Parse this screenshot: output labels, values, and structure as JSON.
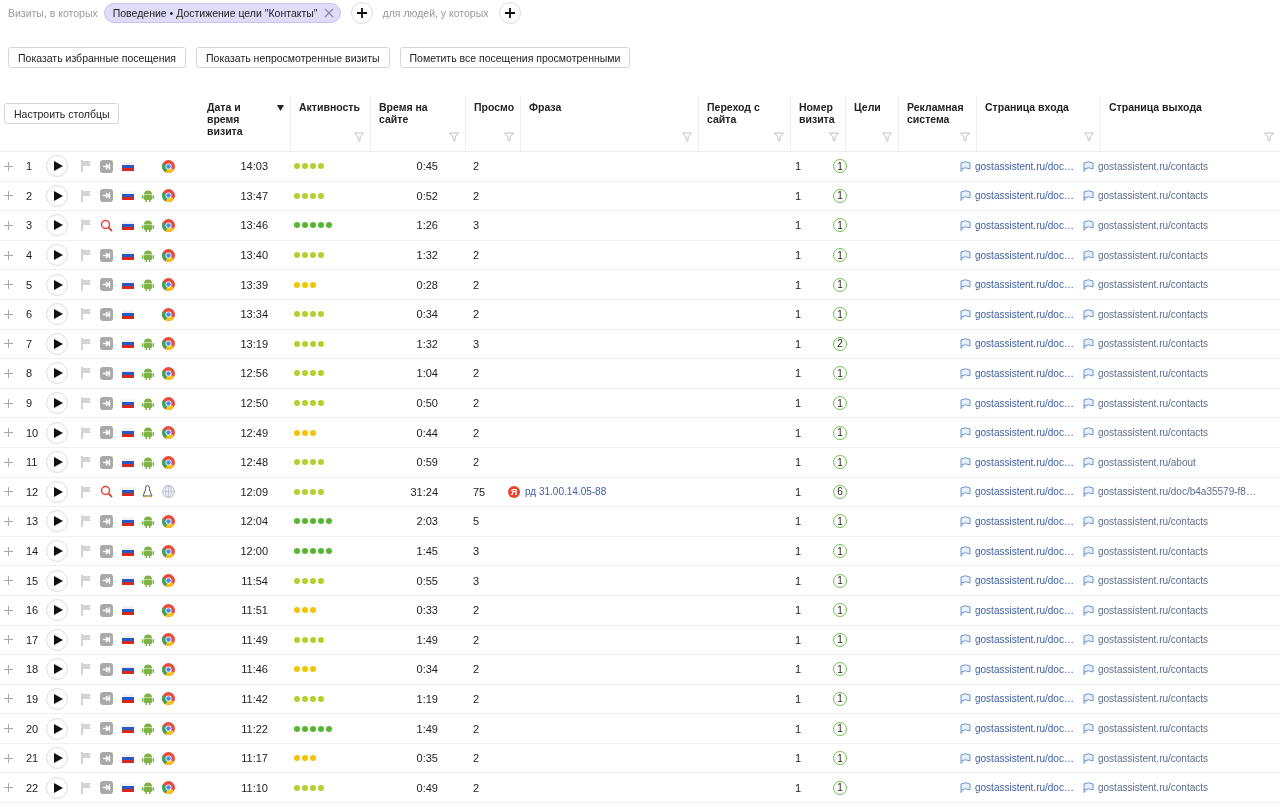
{
  "filter_bar": {
    "label": "Визиты, в которых",
    "condition": "Поведение • Достижение цели \"Контакты\"",
    "people_label": "для людей, у которых"
  },
  "actions": [
    "Показать избранные посещения",
    "Показать непросмотренные визиты",
    "Пометить все посещения просмотренными"
  ],
  "table": {
    "settings_button": "Настроить столбцы",
    "columns": [
      {
        "label": "Дата и время визита",
        "sorted": true,
        "filter": false
      },
      {
        "label": "Активность",
        "sorted": false,
        "filter": true
      },
      {
        "label": "Время на сайте",
        "sorted": false,
        "filter": true
      },
      {
        "label": "Просмо",
        "sorted": false,
        "filter": true
      },
      {
        "label": "Фраза",
        "sorted": false,
        "filter": true
      },
      {
        "label": "Переход с сайта",
        "sorted": false,
        "filter": true
      },
      {
        "label": "Номер визита",
        "sorted": false,
        "filter": true
      },
      {
        "label": "Цели",
        "sorted": false,
        "filter": true
      },
      {
        "label": "Рекламная система",
        "sorted": false,
        "filter": true
      },
      {
        "label": "Страница входа",
        "sorted": false,
        "filter": true
      },
      {
        "label": "Страница выхода",
        "sorted": false,
        "filter": true
      }
    ],
    "rows": [
      {
        "n": "1",
        "source": {
          "kind": "direct"
        },
        "browser": {
          "kind": "chrome"
        },
        "time": "14:03",
        "stars": 4,
        "duration": "0:45",
        "views": "2",
        "visit": "1",
        "goals": "1",
        "entry": "gostassistent.ru/doc…",
        "exit": "gostassistent.ru/contacts"
      },
      {
        "n": "2",
        "source": {
          "kind": "direct"
        },
        "os": {
          "kind": "android"
        },
        "browser": {
          "kind": "chrome"
        },
        "time": "13:47",
        "stars": 4,
        "duration": "0:52",
        "views": "2",
        "visit": "1",
        "goals": "1",
        "entry": "gostassistent.ru/doc…",
        "exit": "gostassistent.ru/contacts"
      },
      {
        "n": "3",
        "source": {
          "kind": "search"
        },
        "os": {
          "kind": "android"
        },
        "browser": {
          "kind": "chrome"
        },
        "time": "13:46",
        "stars": 5,
        "duration": "1:26",
        "views": "3",
        "visit": "1",
        "goals": "1",
        "entry": "gostassistent.ru/doc…",
        "exit": "gostassistent.ru/contacts"
      },
      {
        "n": "4",
        "source": {
          "kind": "direct"
        },
        "os": {
          "kind": "android"
        },
        "browser": {
          "kind": "chrome"
        },
        "time": "13:40",
        "stars": 4,
        "duration": "1:32",
        "views": "2",
        "visit": "1",
        "goals": "1",
        "entry": "gostassistent.ru/doc…",
        "exit": "gostassistent.ru/contacts"
      },
      {
        "n": "5",
        "source": {
          "kind": "direct"
        },
        "os": {
          "kind": "android"
        },
        "browser": {
          "kind": "chrome"
        },
        "time": "13:39",
        "stars": 3,
        "duration": "0:28",
        "views": "2",
        "visit": "1",
        "goals": "1",
        "entry": "gostassistent.ru/doc…",
        "exit": "gostassistent.ru/contacts"
      },
      {
        "n": "6",
        "source": {
          "kind": "direct"
        },
        "browser": {
          "kind": "chrome"
        },
        "time": "13:34",
        "stars": 4,
        "duration": "0:34",
        "views": "2",
        "visit": "1",
        "goals": "1",
        "entry": "gostassistent.ru/doc…",
        "exit": "gostassistent.ru/contacts"
      },
      {
        "n": "7",
        "source": {
          "kind": "direct"
        },
        "os": {
          "kind": "android"
        },
        "browser": {
          "kind": "chrome"
        },
        "time": "13:19",
        "stars": 4,
        "duration": "1:32",
        "views": "3",
        "visit": "1",
        "goals": "2",
        "entry": "gostassistent.ru/doc…",
        "exit": "gostassistent.ru/contacts"
      },
      {
        "n": "8",
        "source": {
          "kind": "direct"
        },
        "os": {
          "kind": "android"
        },
        "browser": {
          "kind": "chrome"
        },
        "time": "12:56",
        "stars": 4,
        "duration": "1:04",
        "views": "2",
        "visit": "1",
        "goals": "1",
        "entry": "gostassistent.ru/doc…",
        "exit": "gostassistent.ru/contacts"
      },
      {
        "n": "9",
        "source": {
          "kind": "direct"
        },
        "os": {
          "kind": "android"
        },
        "browser": {
          "kind": "chrome"
        },
        "time": "12:50",
        "stars": 4,
        "duration": "0:50",
        "views": "2",
        "visit": "1",
        "goals": "1",
        "entry": "gostassistent.ru/doc…",
        "exit": "gostassistent.ru/contacts"
      },
      {
        "n": "10",
        "source": {
          "kind": "direct"
        },
        "os": {
          "kind": "android"
        },
        "browser": {
          "kind": "chrome"
        },
        "time": "12:49",
        "stars": 3,
        "duration": "0:44",
        "views": "2",
        "visit": "1",
        "goals": "1",
        "entry": "gostassistent.ru/doc…",
        "exit": "gostassistent.ru/contacts"
      },
      {
        "n": "11",
        "source": {
          "kind": "direct"
        },
        "os": {
          "kind": "android"
        },
        "browser": {
          "kind": "chrome"
        },
        "time": "12:48",
        "stars": 4,
        "duration": "0:59",
        "views": "2",
        "visit": "1",
        "goals": "1",
        "entry": "gostassistent.ru/doc…",
        "exit": "gostassistent.ru/about"
      },
      {
        "n": "12",
        "source": {
          "kind": "search"
        },
        "os": {
          "kind": "linux"
        },
        "browser": {
          "kind": "other"
        },
        "time": "12:09",
        "stars": 4,
        "duration": "31:24",
        "views": "75",
        "phrase": {
          "engine": "Я",
          "text": "рд 31.00.14.05-88"
        },
        "visit": "1",
        "goals": "6",
        "entry": "gostassistent.ru/doc…",
        "exit": "gostassistent.ru/doc/b4a35579-f8…"
      },
      {
        "n": "13",
        "source": {
          "kind": "direct"
        },
        "os": {
          "kind": "android"
        },
        "browser": {
          "kind": "chrome"
        },
        "time": "12:04",
        "stars": 5,
        "duration": "2:03",
        "views": "5",
        "visit": "1",
        "goals": "1",
        "entry": "gostassistent.ru/doc…",
        "exit": "gostassistent.ru/contacts"
      },
      {
        "n": "14",
        "source": {
          "kind": "direct"
        },
        "os": {
          "kind": "android"
        },
        "browser": {
          "kind": "chrome"
        },
        "time": "12:00",
        "stars": 5,
        "duration": "1:45",
        "views": "3",
        "visit": "1",
        "goals": "1",
        "entry": "gostassistent.ru/doc…",
        "exit": "gostassistent.ru/contacts"
      },
      {
        "n": "15",
        "source": {
          "kind": "direct"
        },
        "os": {
          "kind": "android"
        },
        "browser": {
          "kind": "chrome"
        },
        "time": "11:54",
        "stars": 4,
        "duration": "0:55",
        "views": "3",
        "visit": "1",
        "goals": "1",
        "entry": "gostassistent.ru/doc…",
        "exit": "gostassistent.ru/contacts"
      },
      {
        "n": "16",
        "source": {
          "kind": "direct"
        },
        "browser": {
          "kind": "chrome"
        },
        "time": "11:51",
        "stars": 3,
        "duration": "0:33",
        "views": "2",
        "visit": "1",
        "goals": "1",
        "entry": "gostassistent.ru/doc…",
        "exit": "gostassistent.ru/contacts"
      },
      {
        "n": "17",
        "source": {
          "kind": "direct"
        },
        "os": {
          "kind": "android"
        },
        "browser": {
          "kind": "chrome"
        },
        "time": "11:49",
        "stars": 4,
        "duration": "1:49",
        "views": "2",
        "visit": "1",
        "goals": "1",
        "entry": "gostassistent.ru/doc…",
        "exit": "gostassistent.ru/contacts"
      },
      {
        "n": "18",
        "source": {
          "kind": "direct"
        },
        "os": {
          "kind": "android"
        },
        "browser": {
          "kind": "chrome"
        },
        "time": "11:46",
        "stars": 3,
        "duration": "0:34",
        "views": "2",
        "visit": "1",
        "goals": "1",
        "entry": "gostassistent.ru/doc…",
        "exit": "gostassistent.ru/contacts"
      },
      {
        "n": "19",
        "source": {
          "kind": "direct"
        },
        "os": {
          "kind": "android"
        },
        "browser": {
          "kind": "chrome"
        },
        "time": "11:42",
        "stars": 4,
        "duration": "1:19",
        "views": "2",
        "visit": "1",
        "goals": "1",
        "entry": "gostassistent.ru/doc…",
        "exit": "gostassistent.ru/contacts"
      },
      {
        "n": "20",
        "source": {
          "kind": "direct"
        },
        "os": {
          "kind": "android"
        },
        "browser": {
          "kind": "chrome"
        },
        "time": "11:22",
        "stars": 5,
        "duration": "1:49",
        "views": "2",
        "visit": "1",
        "goals": "1",
        "entry": "gostassistent.ru/doc…",
        "exit": "gostassistent.ru/contacts"
      },
      {
        "n": "21",
        "source": {
          "kind": "direct"
        },
        "os": {
          "kind": "android"
        },
        "browser": {
          "kind": "chrome"
        },
        "time": "11:17",
        "stars": 3,
        "duration": "0:35",
        "views": "2",
        "visit": "1",
        "goals": "1",
        "entry": "gostassistent.ru/doc…",
        "exit": "gostassistent.ru/contacts"
      },
      {
        "n": "22",
        "source": {
          "kind": "direct"
        },
        "os": {
          "kind": "android"
        },
        "browser": {
          "kind": "chrome"
        },
        "time": "11:10",
        "stars": 4,
        "duration": "0:49",
        "views": "2",
        "visit": "1",
        "goals": "1",
        "entry": "gostassistent.ru/doc…",
        "exit": "gostassistent.ru/contacts"
      }
    ]
  }
}
